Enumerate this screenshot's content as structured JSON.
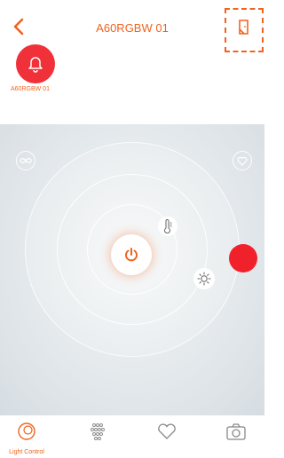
{
  "header": {
    "title": "A60RGBW 01",
    "back_icon": "chevron-left-icon",
    "door_icon": "door-icon"
  },
  "device": {
    "label": "A60RGBW 01",
    "icon": "bell-icon",
    "color": "#F0313A"
  },
  "control": {
    "left_icon": "infinity-icon",
    "right_icon": "heart-icon",
    "power_icon": "power-icon",
    "temperature_icon": "thermometer-icon",
    "brightness_icon": "brightness-icon",
    "color_marker": "#F0212B"
  },
  "tabs": [
    {
      "icon": "light-control-icon",
      "label": "Light Control",
      "active": true
    },
    {
      "icon": "scenes-dots-icon",
      "label": "",
      "active": false
    },
    {
      "icon": "heart-icon",
      "label": "",
      "active": false
    },
    {
      "icon": "camera-icon",
      "label": "",
      "active": false
    }
  ],
  "colors": {
    "accent": "#F0631F",
    "red": "#F0212B"
  }
}
